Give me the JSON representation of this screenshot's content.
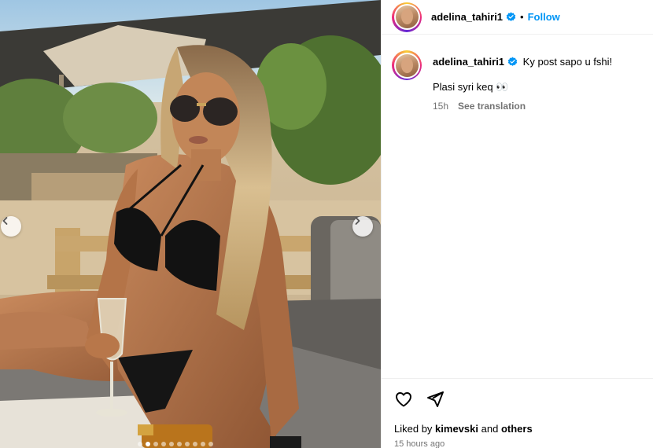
{
  "post": {
    "username": "adelina_tahiri1",
    "separator": "•",
    "follow_label": "Follow",
    "caption_line1": "Ky post sapo u fshi!",
    "caption_line2": "Plasi syri keq 👀",
    "caption_age": "15h",
    "see_translation": "See translation",
    "liked_by_prefix": "Liked by",
    "liked_by_user": "kimevski",
    "liked_by_and": "and",
    "liked_by_others": "others",
    "timestamp": "15 hours ago"
  },
  "carousel": {
    "slide_count": 10,
    "active_index": 1
  },
  "icons": {
    "verified": "verified-badge-icon",
    "like": "heart-icon",
    "share": "paper-plane-icon",
    "prev": "chevron-left-icon",
    "next": "chevron-right-icon"
  },
  "colors": {
    "accent": "#0095f6",
    "secondary_text": "#737373",
    "border": "#efefef"
  }
}
